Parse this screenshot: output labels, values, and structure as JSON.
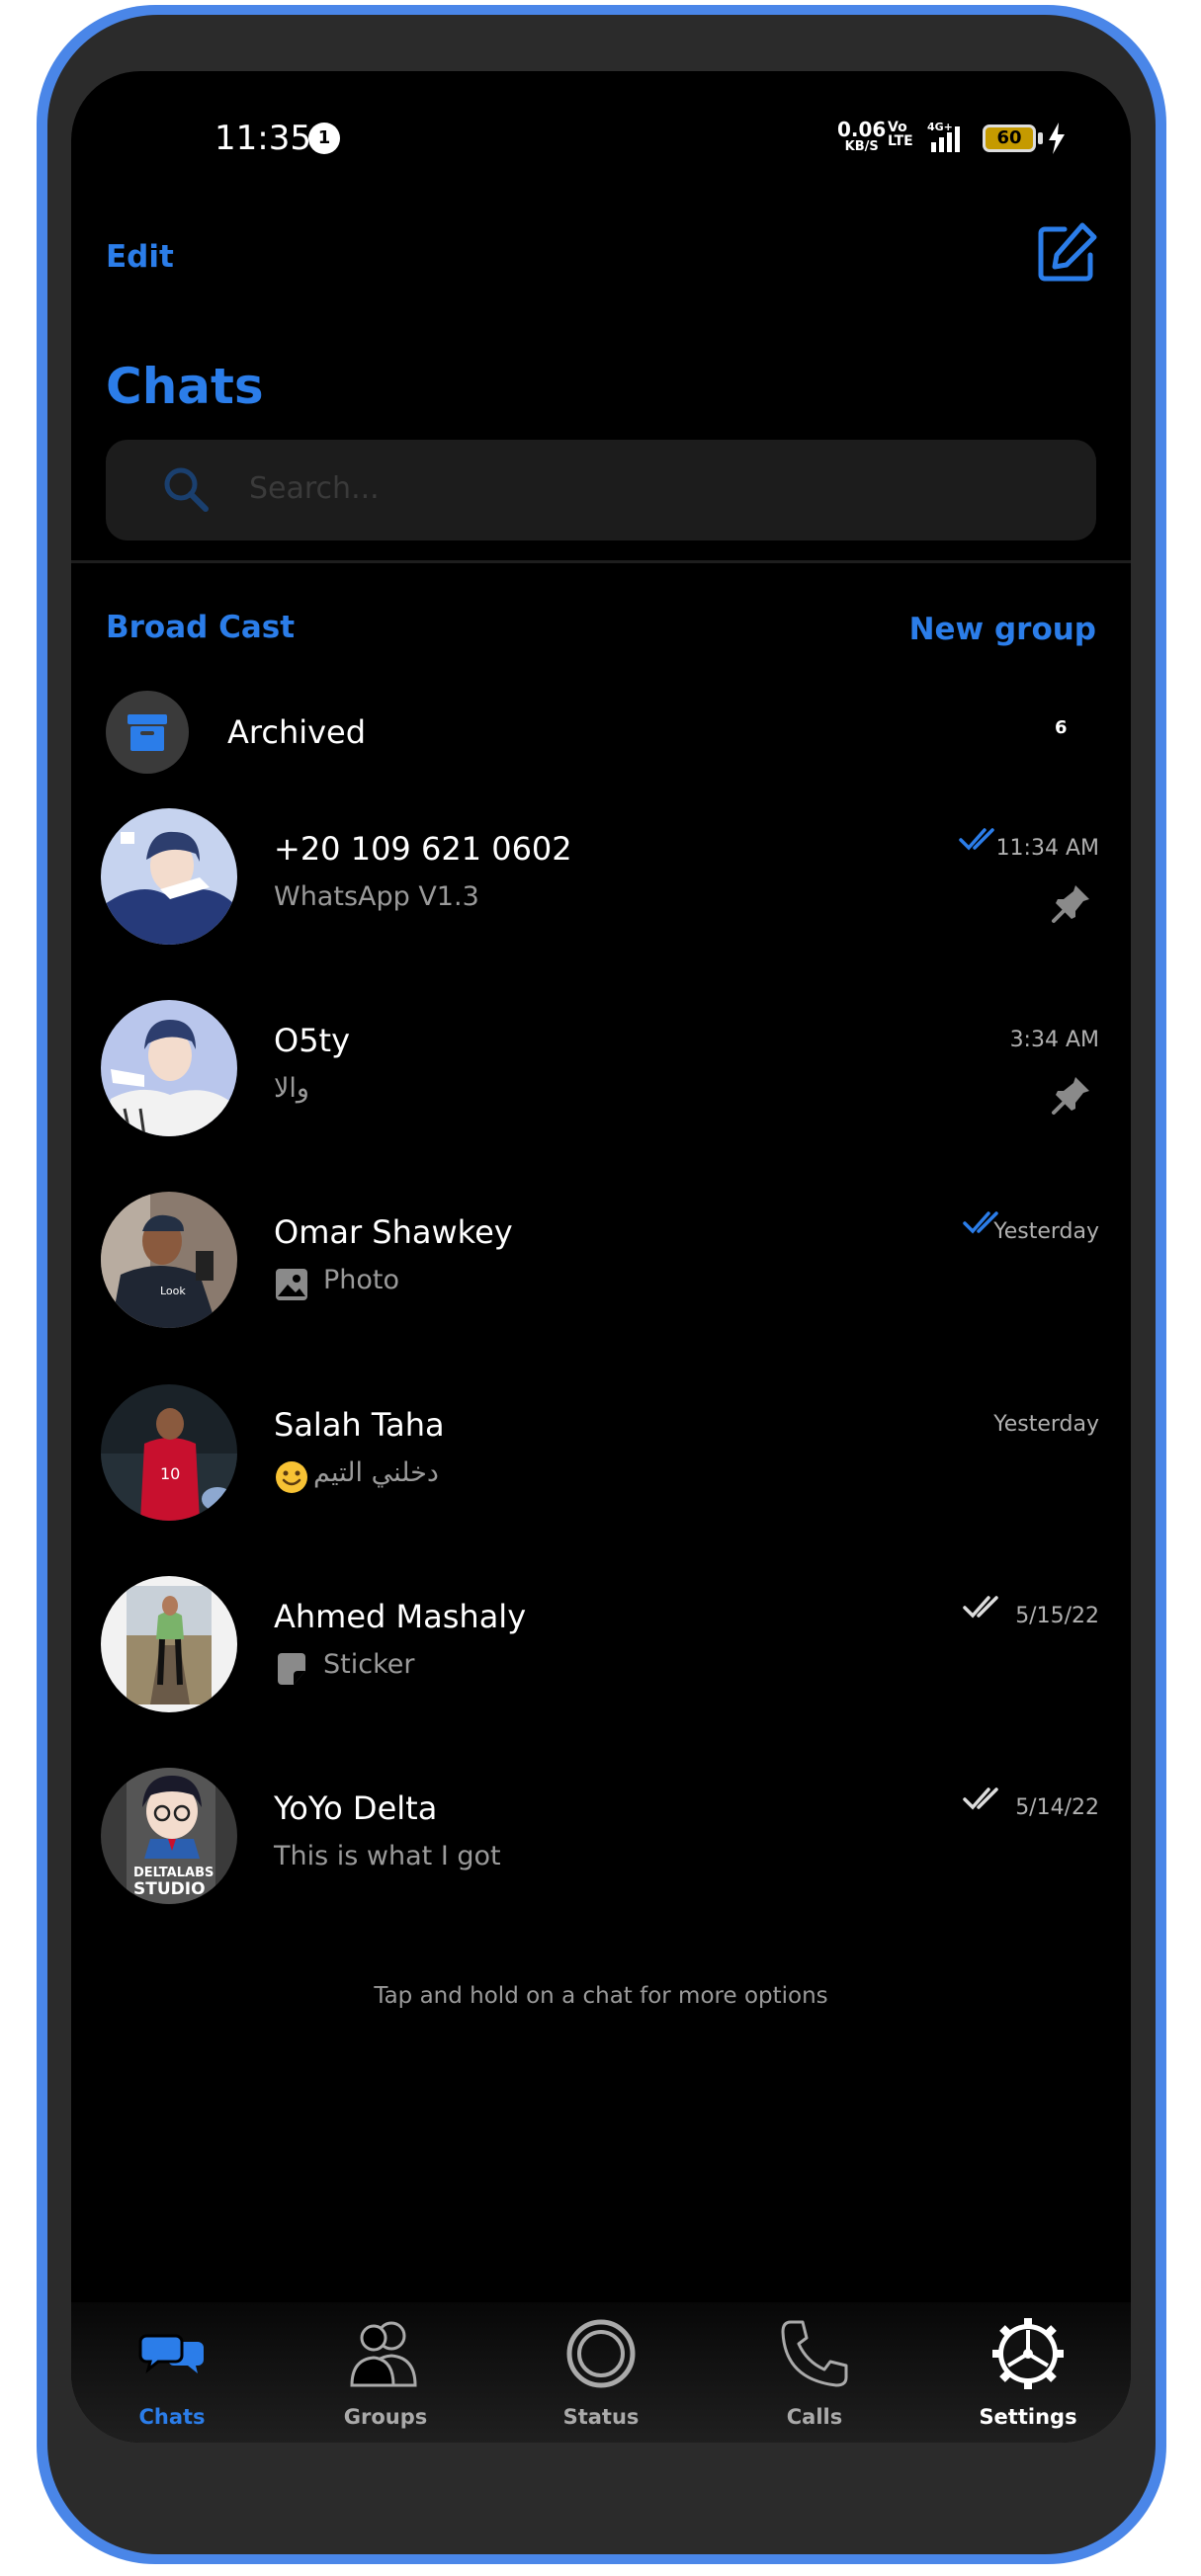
{
  "status_bar": {
    "time": "11:35",
    "notification_count": "1",
    "net_speed": "0.06",
    "net_speed_unit": "KB/S",
    "volte": "Vo",
    "volte_sub": "LTE",
    "network": "4G+",
    "battery": "60"
  },
  "header": {
    "edit_label": "Edit",
    "title": "Chats",
    "search_placeholder": "Search..."
  },
  "actions": {
    "broadcast_label": "Broad Cast",
    "new_group_label": "New group"
  },
  "archived": {
    "label": "Archived",
    "count": "6"
  },
  "chats": [
    {
      "name": "+20 109 621 0602",
      "preview": "WhatsApp V1.3",
      "time": "11:34 AM",
      "ticks": "read",
      "pinned": true
    },
    {
      "name": "O5ty",
      "preview": "والا",
      "time": "3:34 AM",
      "ticks": "none",
      "pinned": true
    },
    {
      "name": "Omar Shawkey",
      "preview": "Photo",
      "preview_icon": "photo-icon",
      "time": "Yesterday",
      "ticks": "read",
      "pinned": false
    },
    {
      "name": "Salah Taha",
      "preview": "دخلني التيم",
      "preview_icon": "smiley-emoji-icon",
      "time": "Yesterday",
      "ticks": "none",
      "pinned": false
    },
    {
      "name": "Ahmed Mashaly",
      "preview": "Sticker",
      "preview_icon": "sticker-icon",
      "time": "5/15/22",
      "ticks": "delivered",
      "pinned": false
    },
    {
      "name": "YoYo Delta",
      "preview": "This is what I got",
      "time": "5/14/22",
      "ticks": "delivered",
      "pinned": false
    }
  ],
  "avatars": {
    "avatar_6_line1": "DELTALABS",
    "avatar_6_line2": "STUDIO",
    "avatar_3_shirt": "Look",
    "avatar_4_shirt": "10"
  },
  "hint": "Tap and hold on a chat for more options",
  "tabs": [
    {
      "label": "Chats",
      "icon": "chat-bubbles-icon",
      "active": true
    },
    {
      "label": "Groups",
      "icon": "groups-icon",
      "active": false
    },
    {
      "label": "Status",
      "icon": "status-icon",
      "active": false
    },
    {
      "label": "Calls",
      "icon": "phone-icon",
      "active": false
    },
    {
      "label": "Settings",
      "icon": "settings-icon",
      "active": false
    }
  ],
  "colors": {
    "accent": "#2b7de9",
    "background": "#000000",
    "frame": "#4a86e8",
    "read_tick": "#2b7de9",
    "delivered_tick": "#dddddd"
  }
}
